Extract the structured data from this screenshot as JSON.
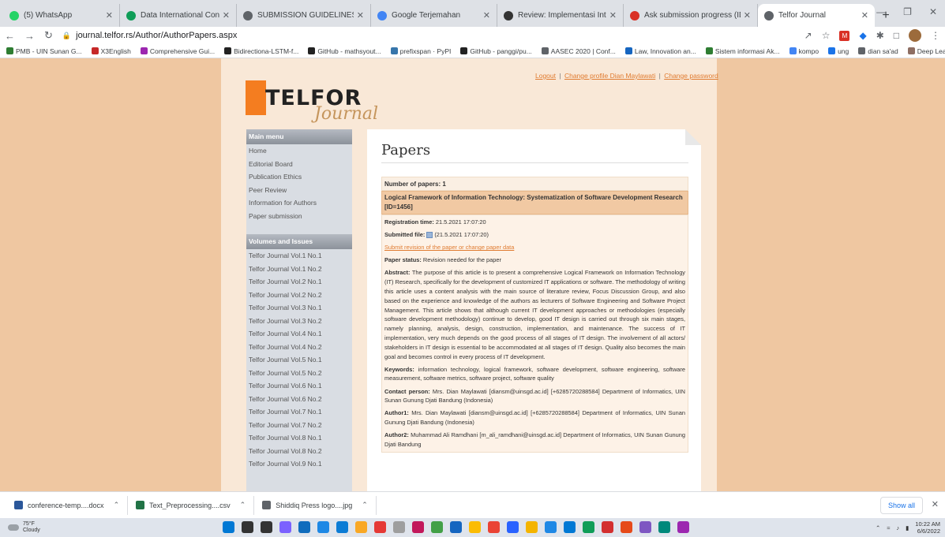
{
  "browser": {
    "tabs": [
      {
        "label": "(5) WhatsApp",
        "icon": "whatsapp-icon",
        "color": "#25d366"
      },
      {
        "label": "Data International Conference",
        "icon": "sheets-icon",
        "color": "#0f9d58"
      },
      {
        "label": "SUBMISSION GUIDELINES – ICV",
        "icon": "globe-icon",
        "color": "#5f6368"
      },
      {
        "label": "Google Terjemahan",
        "icon": "translate-icon",
        "color": "#4285f4"
      },
      {
        "label": "Review: Implementasi Internet",
        "icon": "pkp-icon",
        "color": "#333333"
      },
      {
        "label": "Ask submission progress (ID 14",
        "icon": "gmail-icon",
        "color": "#d93025"
      },
      {
        "label": "Telfor Journal",
        "icon": "globe-icon",
        "color": "#5f6368"
      }
    ],
    "address": "journal.telfor.rs/Author/AuthorPapers.aspx",
    "bookmarks": [
      {
        "label": "PMB - UIN Sunan G...",
        "color": "#2e7d32"
      },
      {
        "label": "X3English",
        "color": "#c62828"
      },
      {
        "label": "Comprehensive Gui...",
        "color": "#9c27b0"
      },
      {
        "label": "Bidirectiona-LSTM-f...",
        "color": "#222222"
      },
      {
        "label": "GitHub - mathsyout...",
        "color": "#222222"
      },
      {
        "label": "prefixspan · PyPI",
        "color": "#3776ab"
      },
      {
        "label": "GitHub - panggi/pu...",
        "color": "#222222"
      },
      {
        "label": "AASEC 2020 | Conf...",
        "color": "#5f6368"
      },
      {
        "label": "Law, Innovation an...",
        "color": "#1565c0"
      },
      {
        "label": "Sistem informasi Ak...",
        "color": "#2e7d32"
      },
      {
        "label": "kompo",
        "color": "#4285f4"
      },
      {
        "label": "ung",
        "color": "#1a73e8"
      },
      {
        "label": "dian sa'ad",
        "color": "#5f6368"
      },
      {
        "label": "Deep Learning, NLP...",
        "color": "#8d6e63"
      }
    ]
  },
  "header": {
    "logo_text": "TELFOR",
    "logo_sub": "Journal",
    "logout": "Logout",
    "change_profile": "Change profile Dian Maylawati",
    "change_password": "Change password",
    "sep": "|"
  },
  "menu": {
    "main_title": "Main menu",
    "main_items": [
      "Home",
      "Editorial Board",
      "Publication Ethics",
      "Peer Review",
      "Information for Authors",
      "Paper submission"
    ],
    "volumes_title": "Volumes and Issues",
    "volumes": [
      "Telfor Journal Vol.1 No.1",
      "Telfor Journal Vol.1 No.2",
      "Telfor Journal Vol.2 No.1",
      "Telfor Journal Vol.2 No.2",
      "Telfor Journal Vol.3 No.1",
      "Telfor Journal Vol.3 No.2",
      "Telfor Journal Vol.4 No.1",
      "Telfor Journal Vol.4 No.2",
      "Telfor Journal Vol.5 No.1",
      "Telfor Journal Vol.5 No.2",
      "Telfor Journal Vol.6 No.1",
      "Telfor Journal Vol.6 No.2",
      "Telfor Journal Vol.7 No.1",
      "Telfor Journal Vol.7 No.2",
      "Telfor Journal Vol.8 No.1",
      "Telfor Journal Vol.8 No.2",
      "Telfor Journal Vol.9 No.1"
    ]
  },
  "content": {
    "heading": "Papers",
    "number_of_papers": "Number of papers: 1",
    "paper_title": "Logical Framework of Information Technology: Systematization of Software Development Research [ID=1456]",
    "registration_label": "Registration time:",
    "registration_value": "21.5.2021 17:07:20",
    "submitted_label": "Submitted file:",
    "submitted_value": "(21.5.2021 17:07:20)",
    "revision_link": "Submit revision of the paper or change paper data",
    "status_label": "Paper status:",
    "status_value": "Revision needed for the paper",
    "abstract_label": "Abstract:",
    "abstract_value": "The purpose of this article is to present a comprehensive Logical Framework on Information Technology (IT) Research, specifically for the development of customized IT applications or software. The methodology of writing this article uses a content analysis with the main source of literature review, Focus Discussion Group, and also based on the experience and knowledge of the authors as lecturers of Software Engineering and Software Project Management. This article shows that although current IT development approaches or methodologies (especially software development methodology) continue to develop, good IT design is carried out through six main stages, namely planning, analysis, design, construction, implementation, and maintenance. The success of IT implementation, very much depends on the good process of all stages of IT design. The involvement of all actors/ stakeholders in IT design is essential to be accommodated at all stages of IT design. Quality also becomes the main goal and becomes control in every process of IT development.",
    "keywords_label": "Keywords:",
    "keywords_value": "information technology, logical framework, software development, software engineering, software measurement, software metrics, software project, software quality",
    "contact_label": "Contact person:",
    "contact_value": "Mrs. Dian Maylawati [diansm@uinsgd.ac.id] [+6285720288584] Department of Informatics, UIN Sunan Gunung Djati Bandung (Indonesia)",
    "author1_label": "Author1:",
    "author1_value": "Mrs. Dian Maylawati [diansm@uinsgd.ac.id] [+6285720288584] Department of Informatics, UIN Sunan Gunung Djati Bandung (Indonesia)",
    "author2_label": "Author2:",
    "author2_value": "Muhammad Ali Ramdhani [m_ali_ramdhani@uinsgd.ac.id] Department of Informatics, UIN Sunan Gunung Djati Bandung"
  },
  "downloads": [
    {
      "name": "conference-temp....docx",
      "color": "#2b579a"
    },
    {
      "name": "Text_Preprocessing....csv",
      "color": "#217346"
    },
    {
      "name": "Shiddiq Press logo....jpg",
      "color": "#5f6368"
    }
  ],
  "show_all": "Show all",
  "taskbar": {
    "temp": "75°F",
    "weather": "Cloudy",
    "time": "10:22 AM",
    "date": "6/6/2022",
    "icons": [
      "#0078d4",
      "#333333",
      "#333333",
      "#7b61ff",
      "#0f6cbd",
      "#1e88e5",
      "#0c7cd5",
      "#f9a825",
      "#e53935",
      "#9e9e9e",
      "#c2185b",
      "#43a047",
      "#1565c0",
      "#fbbc04",
      "#ea4335",
      "#2962ff",
      "#f4b400",
      "#1e88e5",
      "#0078d4",
      "#0f9d58",
      "#d32f2f",
      "#e64a19",
      "#7e57c2",
      "#00897b",
      "#9c27b0"
    ]
  }
}
